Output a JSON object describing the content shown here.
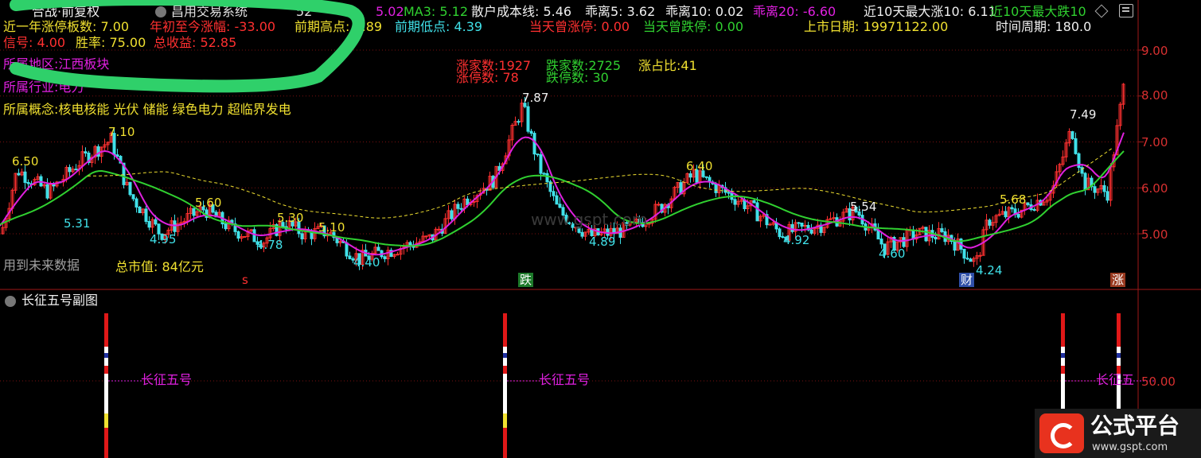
{
  "header": {
    "title_tail": "昌用交易系统",
    "ma_left": "5.02",
    "ma3": "MA3: 5.12",
    "retail_cost": "散户成本线: 5.46",
    "bias5": "乖离5: 3.62",
    "bias10": "乖离10: 0.02",
    "bias20": "乖离20: -6.60",
    "max_rise10": "近10天最大涨10: 6.11",
    "max_fall10": "近10天最大跌10",
    "legend_value": "52",
    "brand_label": "合战·前复权"
  },
  "row2": {
    "limit_count": "近一年涨停板数: 7.00",
    "ytd_change": "年初至今涨幅: -33.00",
    "prev_high": "前期高点: 7.89",
    "prev_low": "前期低点: 4.39",
    "day_limit_up": "当天曾涨停: 0.00",
    "day_limit_down": "当天曾跌停: 0.00",
    "listing_date": "上市日期: 19971122.00",
    "time_period": "时间周期: 180.0"
  },
  "row3": {
    "signal": "信号: 4.00",
    "win_rate": "胜率: 75.00",
    "total_profit": "总收益: 52.85"
  },
  "info": {
    "region": "所属地区:江西板块",
    "industry": "所属行业:电力",
    "concepts": "所属概念:核电核能 光伏 储能 绿色电力 超临界发电",
    "future_data": "用到未来数据",
    "market_cap": "总市值: 84亿元"
  },
  "market_stats": {
    "up_count": "涨家数:1927",
    "down_count": "跌家数:2725",
    "ratio": "涨占比:41",
    "limit_up": "涨停数: 78",
    "limit_down": "跌停数: 30"
  },
  "price_axis": [
    "9.00",
    "8.00",
    "7.00",
    "6.00",
    "5.00"
  ],
  "sub_axis": "50.00",
  "peak_labels": [
    "6.50",
    "7.10",
    "5.31",
    "5.60",
    "4.95",
    "5.30",
    "4.78",
    "5.10",
    "4.40",
    "7.87",
    "4.89",
    "6.40",
    "4.92",
    "5.54",
    "4.60",
    "5.68",
    "4.24",
    "7.49"
  ],
  "badges": {
    "s": "s",
    "die": "跌",
    "cai": "财",
    "zhang": "涨"
  },
  "watermark": "www.gspt.com",
  "sub_panel": {
    "title": "长征五号副图",
    "marker_label": "长征五号",
    "marker_label_cut": "长征五"
  },
  "logo": {
    "name": "公式平台",
    "url": "www.gspt.com"
  },
  "colors": {
    "up": "#ff3030",
    "down": "#40e0e8",
    "ma_green": "#30d030",
    "ma_magenta": "#e020e0",
    "ma_yellow": "#f0e030",
    "grid": "#7a1010"
  }
}
